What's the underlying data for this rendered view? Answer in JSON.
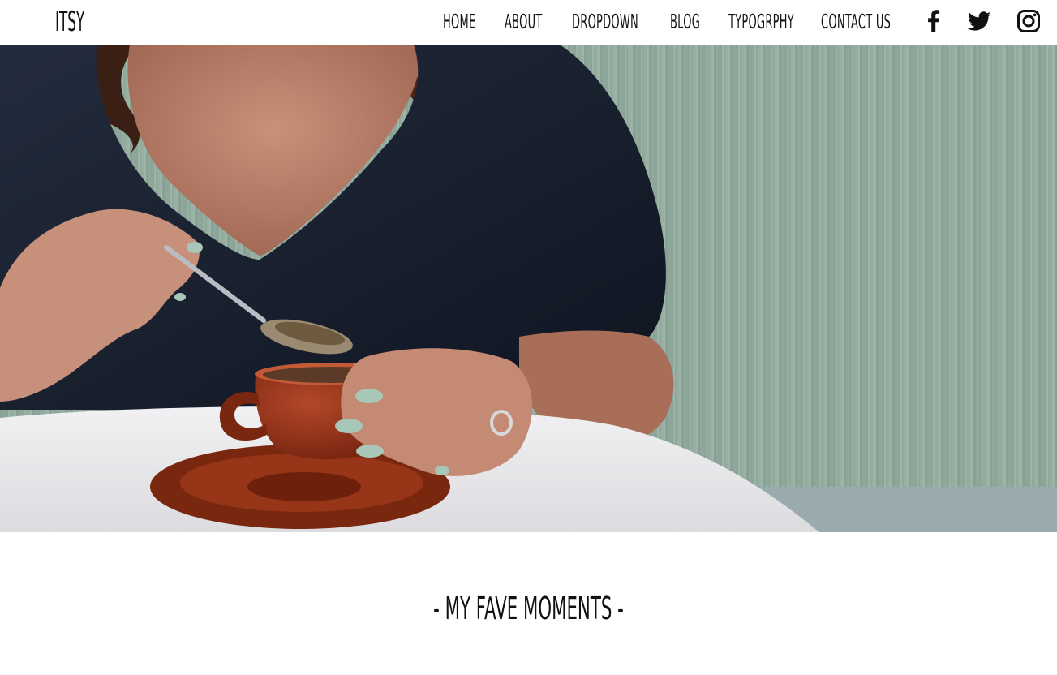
{
  "brand": {
    "name": "ITSY"
  },
  "nav": {
    "items": [
      {
        "label": "HOME"
      },
      {
        "label": "ABOUT"
      },
      {
        "label": "DROPDOWN"
      },
      {
        "label": "BLOG"
      },
      {
        "label": "TYPOGRPHY"
      },
      {
        "label": "CONTACT US"
      }
    ],
    "social": [
      {
        "icon": "facebook-icon"
      },
      {
        "icon": "twitter-icon"
      },
      {
        "icon": "instagram-icon"
      }
    ]
  },
  "hero": {
    "image": "woman-with-coffee-cup-photo"
  },
  "section": {
    "title": "- MY FAVE MOMENTS -"
  },
  "colors": {
    "text": "#111111",
    "background": "#ffffff",
    "wall": "#8fa89c",
    "shirt": "#1c2433",
    "cup": "#8a2e14"
  }
}
